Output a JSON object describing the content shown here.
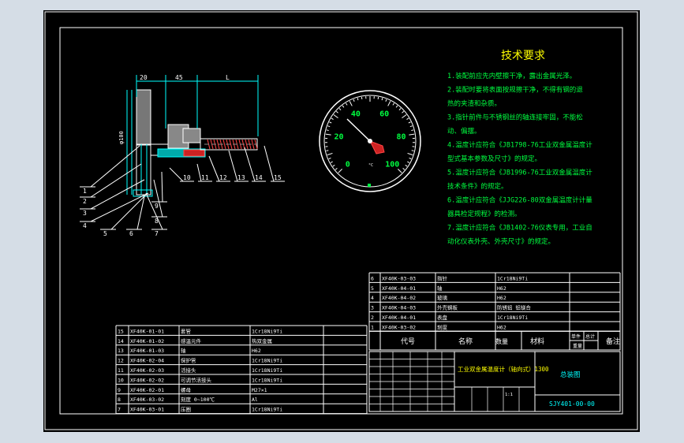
{
  "tech": {
    "title": "技术要求",
    "items": [
      {
        "lines": [
          "1.装配前应先内壁擦干净，露出金属光泽。"
        ]
      },
      {
        "lines": [
          "2.装配时要将表面按规擦干净，不得有钢的退",
          "  热的夹渣和杂质。"
        ]
      },
      {
        "lines": [
          "3.指针前件与不锈钢丝的轴连接牢固，不能松",
          "  动、偏摆。"
        ]
      },
      {
        "lines": [
          "4.温度计应符合《JB1798-76工业双金属温度计",
          "  型式基本参数及尺寸》的规定。"
        ]
      },
      {
        "lines": [
          "5.温度计应符合《JB1996-76工业双金属温度计",
          "  技术条件》的规定。"
        ]
      },
      {
        "lines": [
          "6.温度计应符合《JJG226-80双金属温度计计量",
          "  器具检定规程》的检测。"
        ]
      },
      {
        "lines": [
          "7.温度计应符合《JB1402-76仪表专用，工业自",
          "  动化仪表外壳、外壳尺寸》的规定。"
        ]
      }
    ]
  },
  "gauge": {
    "labels": [
      "0",
      "20",
      "40",
      "60",
      "80",
      "100"
    ],
    "unit_label": "°C"
  },
  "dims": {
    "d1": "20",
    "d2": "45",
    "d3": "L",
    "dv": "φ100"
  },
  "balloons": [
    "1",
    "2",
    "3",
    "4",
    "5",
    "6",
    "7",
    "8",
    "9",
    "10",
    "11",
    "12",
    "13",
    "14",
    "15"
  ],
  "bom_left": [
    {
      "no": "15",
      "code": "XF40K-01-01",
      "name": "套管",
      "mat": "1Cr18Ni9Ti"
    },
    {
      "no": "14",
      "code": "XF40K-01-02",
      "name": "感温元件",
      "mat": "热双金属"
    },
    {
      "no": "13",
      "code": "XF40K-01-03",
      "name": "轴",
      "mat": "H62"
    },
    {
      "no": "12",
      "code": "XF40K-02-04",
      "name": "保护管",
      "mat": "1Cr18Ni9Ti"
    },
    {
      "no": "11",
      "code": "XF40K-02-03",
      "name": "活接头",
      "mat": "1Cr18Ni9Ti"
    },
    {
      "no": "10",
      "code": "XF40K-02-02",
      "name": "可调节活接头",
      "mat": "1Cr18Ni9Ti"
    },
    {
      "no": "9",
      "code": "XF40K-02-01",
      "name": "螺母",
      "mat": "M27×1"
    },
    {
      "no": "8",
      "code": "XF40K-03-02",
      "name": "刻度 0~100℃",
      "mat": "Al"
    },
    {
      "no": "7",
      "code": "XF40K-03-01",
      "name": "压圈",
      "mat": "1Cr18Ni9Ti"
    }
  ],
  "bom_right": [
    {
      "no": "6",
      "code": "XF40K-03-03",
      "name": "指针",
      "mat": "1Cr18Ni9Ti"
    },
    {
      "no": "5",
      "code": "XF40K-04-01",
      "name": "轴",
      "mat": "H62"
    },
    {
      "no": "4",
      "code": "XF40K-04-02",
      "name": "玻璃",
      "mat": "H62"
    },
    {
      "no": "3",
      "code": "XF40K-04-03",
      "name": "外壳钢板",
      "mat": "防锈铝 铝镁合"
    },
    {
      "no": "2",
      "code": "XF40K-04-01",
      "name": "表盘",
      "mat": "1Cr18Ni9Ti"
    },
    {
      "no": "1",
      "code": "XF40K-03-02",
      "name": "刻度",
      "mat": "H62"
    }
  ],
  "header": {
    "code": "代号",
    "name": "名称",
    "qty": "数量",
    "mat": "材料",
    "unit_w": "单件",
    "total_w": "总计",
    "weight": "重量",
    "note": "备注"
  },
  "title_block": {
    "title": "工业双金属温度计（轴向式）1300",
    "drawing": "总装图",
    "number": "SJY401-00-00",
    "scale": "1:1"
  }
}
